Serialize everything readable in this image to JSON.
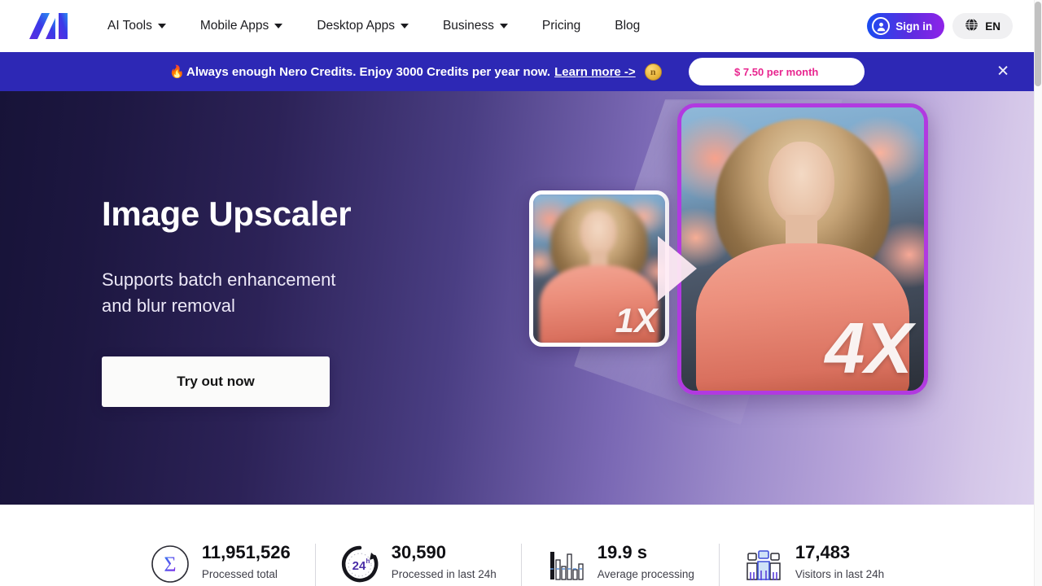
{
  "navbar": {
    "logo_text": "AI",
    "links": [
      {
        "label": "AI Tools",
        "has_dropdown": true
      },
      {
        "label": "Mobile Apps",
        "has_dropdown": true
      },
      {
        "label": "Desktop Apps",
        "has_dropdown": true
      },
      {
        "label": "Business",
        "has_dropdown": true
      },
      {
        "label": "Pricing",
        "has_dropdown": false
      },
      {
        "label": "Blog",
        "has_dropdown": false
      }
    ],
    "signin_label": "Sign in",
    "language_label": "EN"
  },
  "promo": {
    "fire_emoji": "🔥",
    "text": "Always enough Nero Credits. Enjoy 3000 Credits per year now.",
    "link_label": "Learn more ->",
    "coin_glyph": "n",
    "price_label": "$ 7.50 per month",
    "close_glyph": "✕"
  },
  "hero": {
    "title": "Image Upscaler",
    "subtitle": "Supports batch enhancement\nand blur removal",
    "cta_label": "Try out now",
    "before_label": "1X",
    "after_label": "4X"
  },
  "stats": [
    {
      "icon": "sigma-icon",
      "value": "11,951,526",
      "label": "Processed total"
    },
    {
      "icon": "clock-24h-icon",
      "value": "30,590",
      "label": "Processed in last 24h"
    },
    {
      "icon": "bar-chart-icon",
      "value": "19.9 s",
      "label": "Average processing"
    },
    {
      "icon": "visitors-icon",
      "value": "17,483",
      "label": "Visitors in last 24h"
    }
  ],
  "colors": {
    "promo_bg": "#2d28b5",
    "price_text": "#e8268f",
    "accent_blue": "#1a4cf0",
    "accent_purple": "#8f23e8",
    "card_border": "#b13ae0"
  }
}
